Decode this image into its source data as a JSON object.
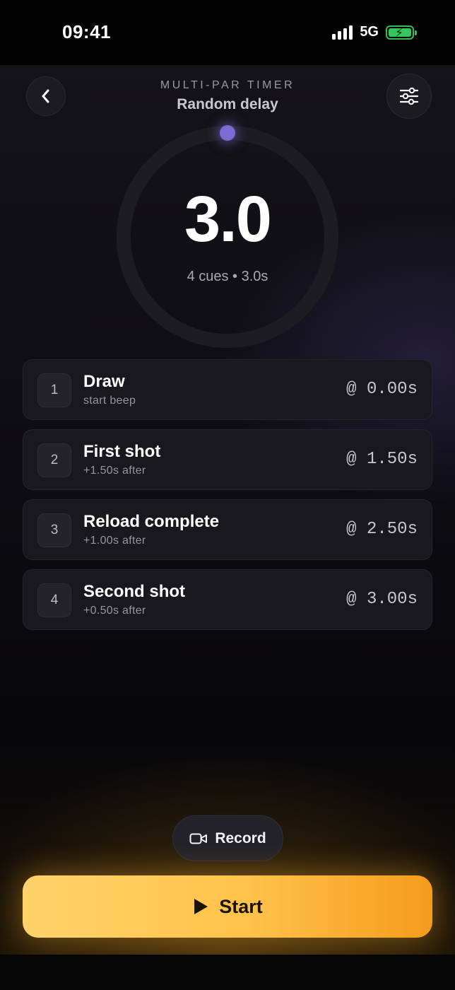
{
  "status_bar": {
    "time": "09:41",
    "network": "5G",
    "battery_level": 1.0,
    "battery_color": "#34c759",
    "signal_bars": 4
  },
  "header": {
    "eyebrow": "MULTI-PAR TIMER",
    "title": "Random delay",
    "back_icon": "chevron-left-icon",
    "settings_icon": "sliders-icon"
  },
  "dial": {
    "value": "3.0",
    "subtitle": "4 cues • 3.0s",
    "knob_color": "#7b6cd3"
  },
  "cues": [
    {
      "number": "1",
      "title": "Draw",
      "subtitle": "start beep",
      "time": "@ 0.00s"
    },
    {
      "number": "2",
      "title": "First shot",
      "subtitle": "+1.50s after",
      "time": "@ 1.50s"
    },
    {
      "number": "3",
      "title": "Reload complete",
      "subtitle": "+1.00s after",
      "time": "@ 2.50s"
    },
    {
      "number": "4",
      "title": "Second shot",
      "subtitle": "+0.50s after",
      "time": "@ 3.00s"
    }
  ],
  "record_button": {
    "label": "Record",
    "icon": "video-camera-icon"
  },
  "start_button": {
    "label": "Start",
    "icon": "play-icon",
    "color_start": "#ffd36a",
    "color_end": "#f59b1c"
  }
}
